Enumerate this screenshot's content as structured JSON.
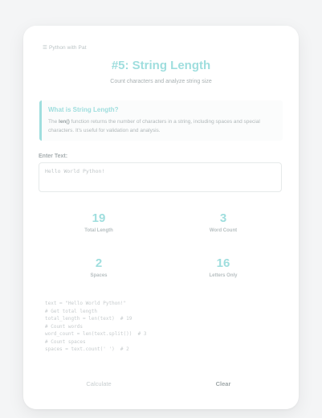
{
  "brand": {
    "symbol": "☰",
    "text": "Python with Pat"
  },
  "header": {
    "title": "#5: String Length",
    "subtitle": "Count characters and analyze string size"
  },
  "info": {
    "heading": "What is String Length?",
    "body_pre": "The ",
    "body_fn": "len()",
    "body_post": " function returns the number of characters in a string, including spaces and special characters. It's useful for validation and analysis."
  },
  "input": {
    "label": "Enter Text:",
    "value": "Hello World Python!"
  },
  "stats": [
    {
      "value": "19",
      "label": "Total Length"
    },
    {
      "value": "3",
      "label": "Word Count"
    },
    {
      "value": "2",
      "label": "Spaces"
    },
    {
      "value": "16",
      "label": "Letters Only"
    }
  ],
  "code_lines": [
    "text = \"Hello World Python!\"",
    "# Get total length",
    "total_length = len(text)  # 19",
    "# Count words",
    "word_count = len(text.split())  # 3",
    "# Count spaces",
    "spaces = text.count(' ')  # 2"
  ],
  "buttons": {
    "calculate": "Calculate",
    "clear": "Clear"
  },
  "colors": {
    "accent": "#9fdede",
    "background": "#f4f5f6",
    "card": "#ffffff"
  }
}
